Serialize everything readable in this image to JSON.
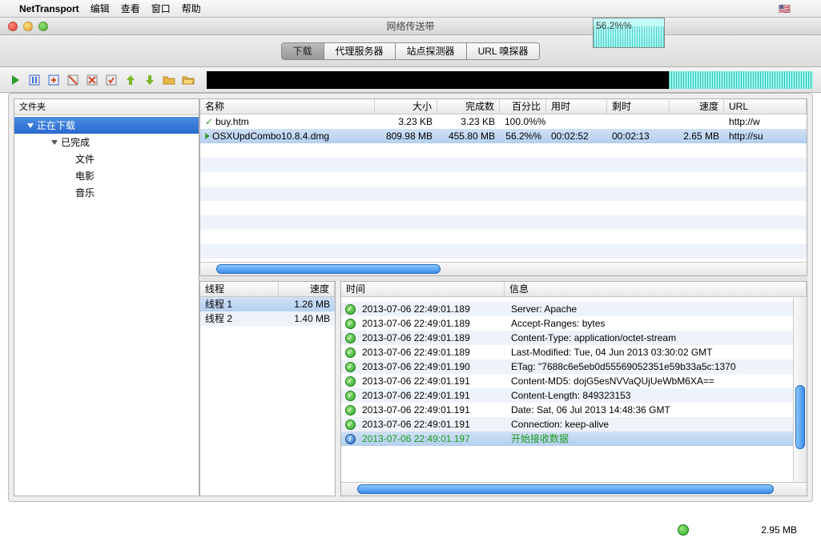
{
  "menubar": {
    "appname": "NetTransport",
    "items": [
      "编辑",
      "查看",
      "窗口",
      "帮助"
    ]
  },
  "window": {
    "title": "网络传送带"
  },
  "speed_overlay": "56.2%%",
  "tabs": [
    "下载",
    "代理服务器",
    "站点探测器",
    "URL 嗅探器"
  ],
  "tabs_active": 0,
  "sidebar": {
    "header": "文件夹",
    "items": [
      {
        "label": "正在下载",
        "indent": 0,
        "sel": true,
        "arrow": true
      },
      {
        "label": "已完成",
        "indent": 1,
        "sel": false,
        "arrow": true
      },
      {
        "label": "文件",
        "indent": 2,
        "sel": false
      },
      {
        "label": "电影",
        "indent": 2,
        "sel": false
      },
      {
        "label": "音乐",
        "indent": 2,
        "sel": false
      }
    ]
  },
  "download_cols": [
    "名称",
    "大小",
    "完成数",
    "百分比",
    "用时",
    "剩时",
    "速度",
    "URL"
  ],
  "downloads": [
    {
      "icon": "check",
      "name": "buy.htm",
      "size": "3.23 KB",
      "done": "3.23 KB",
      "pct": "100.0%%",
      "used": "",
      "rem": "",
      "spd": "",
      "url": "http://w",
      "sel": false
    },
    {
      "icon": "play",
      "name": "OSXUpdCombo10.8.4.dmg",
      "size": "809.98 MB",
      "done": "455.80 MB",
      "pct": "56.2%%",
      "used": "00:02:52",
      "rem": "00:02:13",
      "spd": "2.65 MB",
      "url": "http://su",
      "sel": true
    }
  ],
  "thread_cols": [
    "线程",
    "速度"
  ],
  "threads": [
    {
      "name": "线程 1",
      "speed": "1.26 MB",
      "sel": true
    },
    {
      "name": "线程 2",
      "speed": "1.40 MB",
      "sel": false
    }
  ],
  "log_cols": [
    "时间",
    "信息"
  ],
  "logs": [
    {
      "icon": "ok",
      "ts": "2013-07-06 22:49:01.189",
      "msg": "Server: Apache"
    },
    {
      "icon": "ok",
      "ts": "2013-07-06 22:49:01.189",
      "msg": "Accept-Ranges: bytes"
    },
    {
      "icon": "ok",
      "ts": "2013-07-06 22:49:01.189",
      "msg": "Content-Type: application/octet-stream"
    },
    {
      "icon": "ok",
      "ts": "2013-07-06 22:49:01.189",
      "msg": "Last-Modified: Tue, 04 Jun 2013 03:30:02 GMT"
    },
    {
      "icon": "ok",
      "ts": "2013-07-06 22:49:01.190",
      "msg": "ETag: \"7688c6e5eb0d55569052351e59b33a5c:1370"
    },
    {
      "icon": "ok",
      "ts": "2013-07-06 22:49:01.191",
      "msg": "Content-MD5: dojG5esNVVaQUjUeWbM6XA=="
    },
    {
      "icon": "ok",
      "ts": "2013-07-06 22:49:01.191",
      "msg": "Content-Length: 849323153"
    },
    {
      "icon": "ok",
      "ts": "2013-07-06 22:49:01.191",
      "msg": "Date: Sat, 06 Jul 2013 14:48:36 GMT"
    },
    {
      "icon": "ok",
      "ts": "2013-07-06 22:49:01.191",
      "msg": "Connection: keep-alive"
    },
    {
      "icon": "info",
      "ts": "2013-07-06 22:49:01.197",
      "msg": "开始接收数据",
      "green": true,
      "sel": true
    }
  ],
  "status_speed": "2.95 MB",
  "toolbar_icons": [
    "start-icon",
    "pause-icon",
    "newtask-icon",
    "newbatch-icon",
    "delete-icon",
    "deleteall-icon",
    "moveup-icon",
    "movedown-icon",
    "openfolder-icon",
    "browsefolder-icon"
  ]
}
